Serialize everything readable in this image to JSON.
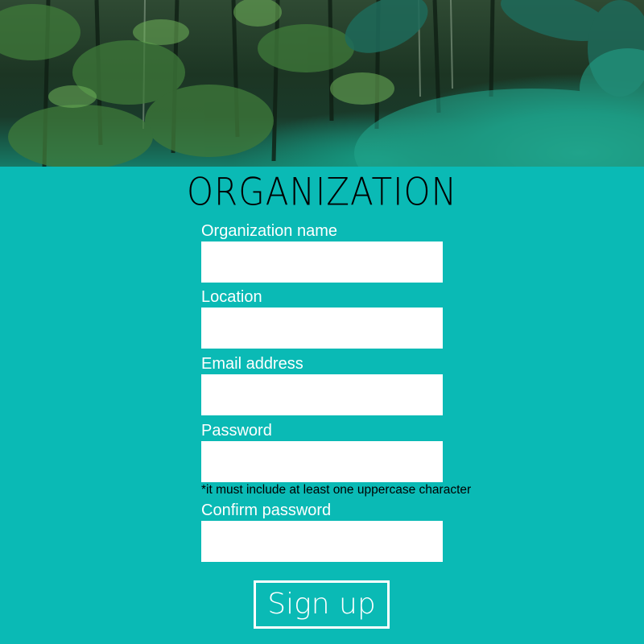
{
  "header": {
    "title": "ORGANIZATION"
  },
  "form": {
    "fields": [
      {
        "label": "Organization name",
        "value": "",
        "placeholder": ""
      },
      {
        "label": "Location",
        "value": "",
        "placeholder": ""
      },
      {
        "label": "Email address",
        "value": "",
        "placeholder": ""
      },
      {
        "label": "Password",
        "value": "",
        "placeholder": ""
      },
      {
        "label": "Confirm password",
        "value": "",
        "placeholder": ""
      }
    ],
    "password_hint": "*it must include at least one uppercase character",
    "submit_label": "Sign up"
  },
  "colors": {
    "background": "#0abab5",
    "label_text": "#ffffff",
    "title_text": "#000000",
    "input_background": "#ffffff",
    "button_border": "#ffffff"
  }
}
